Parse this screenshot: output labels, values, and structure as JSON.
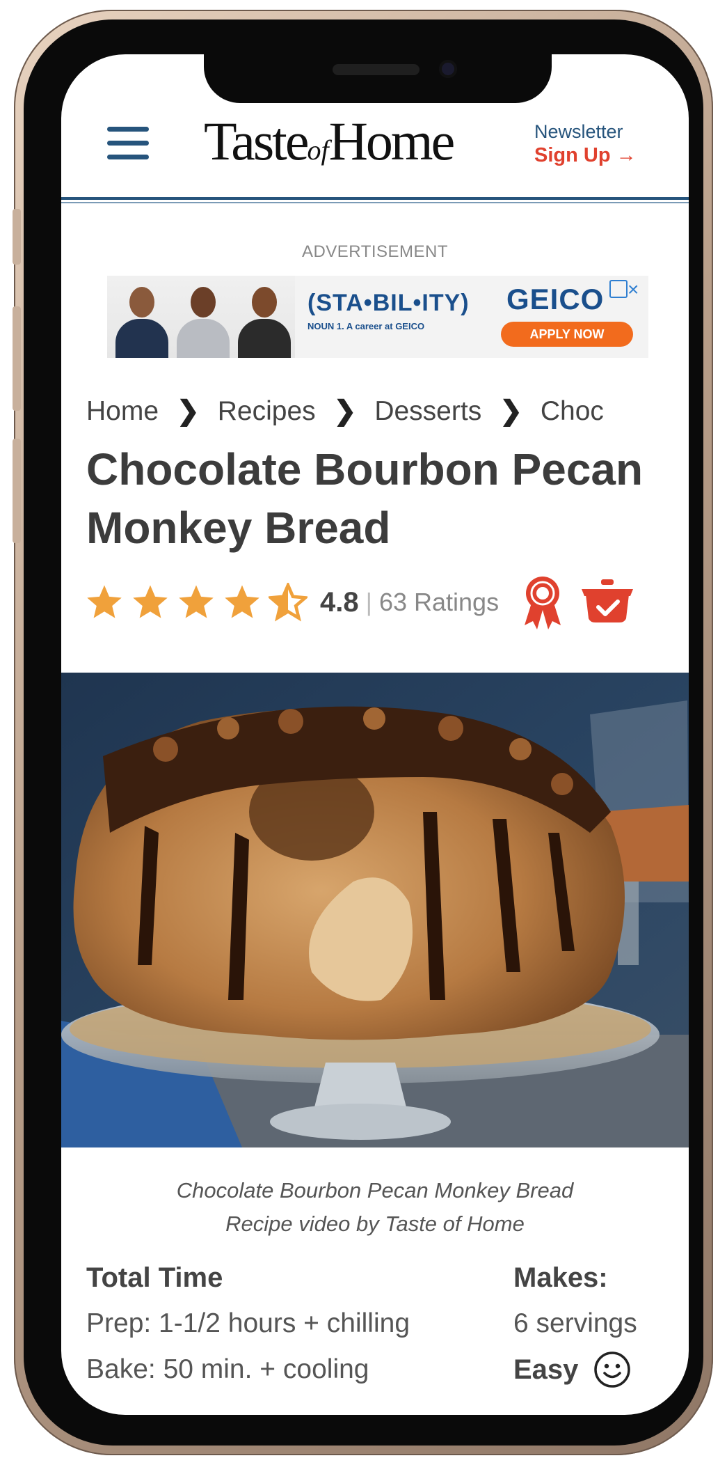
{
  "header": {
    "logo_text_1": "Taste",
    "logo_text_of": "of",
    "logo_text_2": "Home",
    "newsletter_label": "Newsletter",
    "signup_label": "Sign Up →"
  },
  "ad": {
    "label": "ADVERTISEMENT",
    "headline": "(STA•BIL•ITY)",
    "subline": "NOUN 1. A career at GEICO",
    "brand": "GEICO",
    "cta": "APPLY NOW",
    "close": "×"
  },
  "breadcrumb": [
    "Home",
    "Recipes",
    "Desserts",
    "Choc"
  ],
  "recipe": {
    "title": "Chocolate Bourbon Pecan Monkey Bread",
    "rating_value": "4.8",
    "rating_sep": "|",
    "rating_count": "63 Ratings",
    "stars": 4.8,
    "caption_line1": "Chocolate Bourbon Pecan Monkey Bread",
    "caption_line2": "Recipe video by Taste of Home",
    "total_time_label": "Total Time",
    "prep": "Prep:  1-1/2 hours + chilling",
    "bake": "Bake:  50 min. + cooling",
    "makes_label": "Makes:",
    "makes_value": "6 servings",
    "difficulty": "Easy"
  },
  "icons": {
    "menu": "hamburger-menu-icon",
    "award": "award-ribbon-icon",
    "cookbook": "cooking-pot-check-icon",
    "difficulty": "smiley-face-icon"
  },
  "colors": {
    "brand_blue": "#26547c",
    "signup_red": "#e0412e",
    "star_orange": "#f0a13b",
    "badge_red": "#e0412e"
  }
}
